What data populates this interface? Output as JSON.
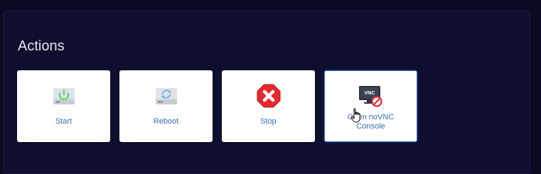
{
  "section": {
    "title": "Actions"
  },
  "actions": [
    {
      "label": "Start",
      "icon": "power-drive-icon"
    },
    {
      "label": "Reboot",
      "icon": "refresh-drive-icon"
    },
    {
      "label": "Stop",
      "icon": "stop-icon"
    },
    {
      "label": "Open noVNC Console",
      "icon": "vnc-disabled-icon"
    }
  ],
  "colors": {
    "background": "#0a0a24",
    "panel": "#0e0e2e",
    "label_text": "#3a6db5",
    "heading_text": "#e6e6f2",
    "stop_red": "#e8282e",
    "power_green": "#5fd46a",
    "hover_border": "#3b6fd8"
  }
}
